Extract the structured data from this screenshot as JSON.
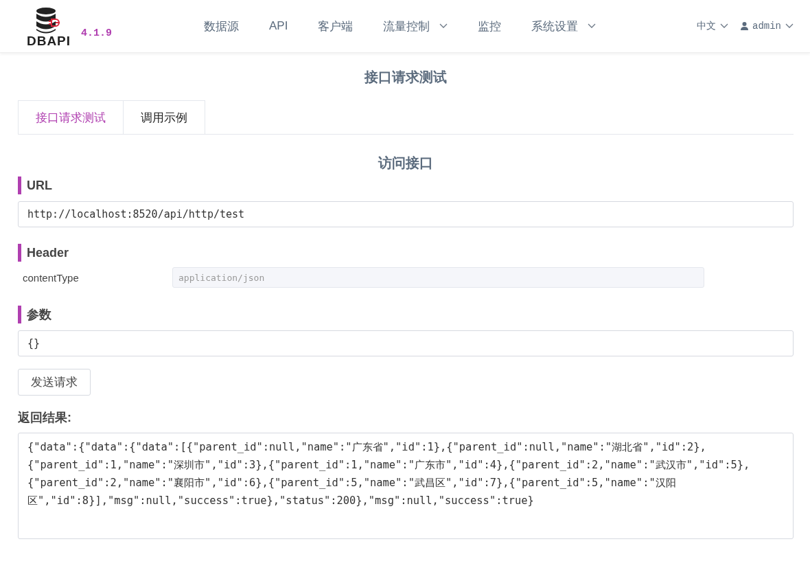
{
  "header": {
    "logo_text": "DBAPI",
    "version": "4.1.9",
    "nav": [
      {
        "label": "数据源",
        "has_menu": false
      },
      {
        "label": "API",
        "has_menu": false
      },
      {
        "label": "客户端",
        "has_menu": false
      },
      {
        "label": "流量控制",
        "has_menu": true
      },
      {
        "label": "监控",
        "has_menu": false
      },
      {
        "label": "系统设置",
        "has_menu": true
      }
    ],
    "language": "中文",
    "user": "admin"
  },
  "page_title": "接口请求测试",
  "tabs": [
    {
      "label": "接口请求测试",
      "selected": true
    },
    {
      "label": "调用示例",
      "selected": false
    }
  ],
  "section_title": "访问接口",
  "url": {
    "label": "URL",
    "value": "http://localhost:8520/api/http/test"
  },
  "header_section": {
    "label": "Header",
    "rows": [
      {
        "name": "contentType",
        "placeholder": "application/json"
      }
    ]
  },
  "params": {
    "label": "参数",
    "value": "{}"
  },
  "send_button": "发送请求",
  "result": {
    "label": "返回结果:",
    "value": "{\"data\":{\"data\":{\"data\":[{\"parent_id\":null,\"name\":\"广东省\",\"id\":1},{\"parent_id\":null,\"name\":\"湖北省\",\"id\":2},{\"parent_id\":1,\"name\":\"深圳市\",\"id\":3},{\"parent_id\":1,\"name\":\"广东市\",\"id\":4},{\"parent_id\":2,\"name\":\"武汉市\",\"id\":5},{\"parent_id\":2,\"name\":\"襄阳市\",\"id\":6},{\"parent_id\":5,\"name\":\"武昌区\",\"id\":7},{\"parent_id\":5,\"name\":\"汉阳区\",\"id\":8}],\"msg\":null,\"success\":true},\"status\":200},\"msg\":null,\"success\":true}"
  }
}
